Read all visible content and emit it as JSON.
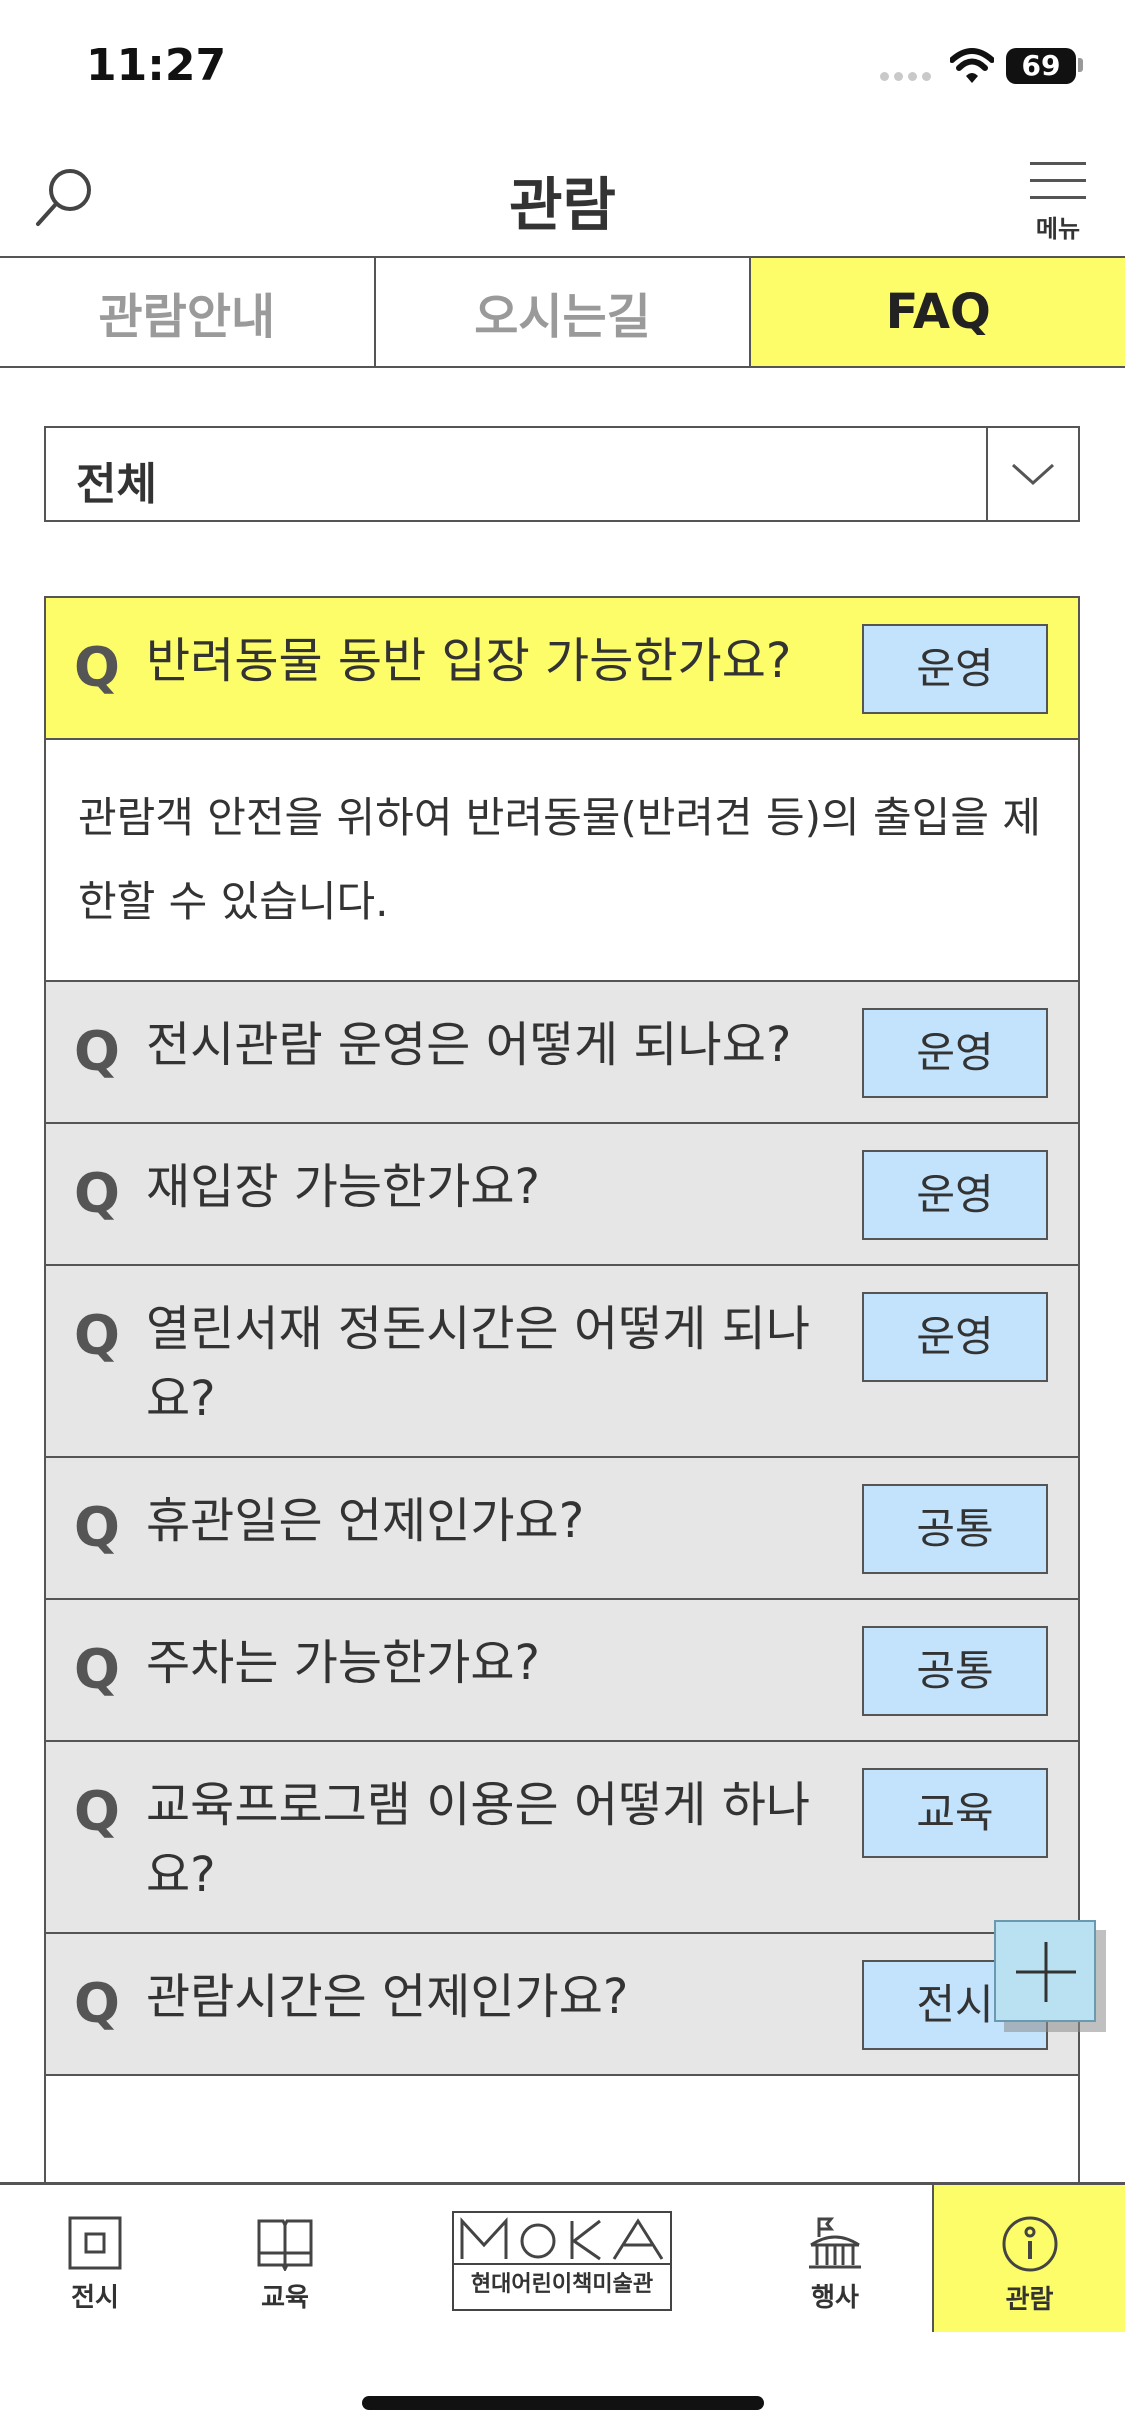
{
  "status_bar": {
    "time": "11:27",
    "battery": "69"
  },
  "header": {
    "title": "관람",
    "menu_label": "메뉴"
  },
  "tabs": [
    {
      "label": "관람안내",
      "active": false
    },
    {
      "label": "오시는길",
      "active": false
    },
    {
      "label": "FAQ",
      "active": true
    }
  ],
  "filter": {
    "selected": "전체"
  },
  "faq": {
    "q_mark": "Q",
    "items": [
      {
        "question": "반려동물 동반 입장 가능한가요?",
        "category": "운영",
        "expanded": true,
        "answer": "관람객 안전을 위하여 반려동물(반려견 등)의 출입을 제한할 수 있습니다."
      },
      {
        "question": "전시관람 운영은 어떻게 되나요?",
        "category": "운영"
      },
      {
        "question": "재입장 가능한가요?",
        "category": "운영"
      },
      {
        "question": "열린서재 정돈시간은 어떻게 되나요?",
        "category": "운영"
      },
      {
        "question": "휴관일은 언제인가요?",
        "category": "공통"
      },
      {
        "question": "주차는 가능한가요?",
        "category": "공통"
      },
      {
        "question": "교육프로그램 이용은 어떻게 하나요?",
        "category": "교육"
      },
      {
        "question": "관람시간은 언제인가요?",
        "category": "전시"
      }
    ]
  },
  "bottom_nav": {
    "items": [
      {
        "label": "전시",
        "icon": "exhibition-icon"
      },
      {
        "label": "교육",
        "icon": "book-icon"
      },
      {
        "label": "행사",
        "icon": "event-icon"
      },
      {
        "label": "관람",
        "icon": "info-icon",
        "active": true
      }
    ],
    "logo_text": "현대어린이책미술관"
  },
  "colors": {
    "accent_yellow": "#fdfd6a",
    "badge_blue": "#c2e3fb",
    "border": "#555555",
    "item_bg": "#e6e6e6"
  }
}
